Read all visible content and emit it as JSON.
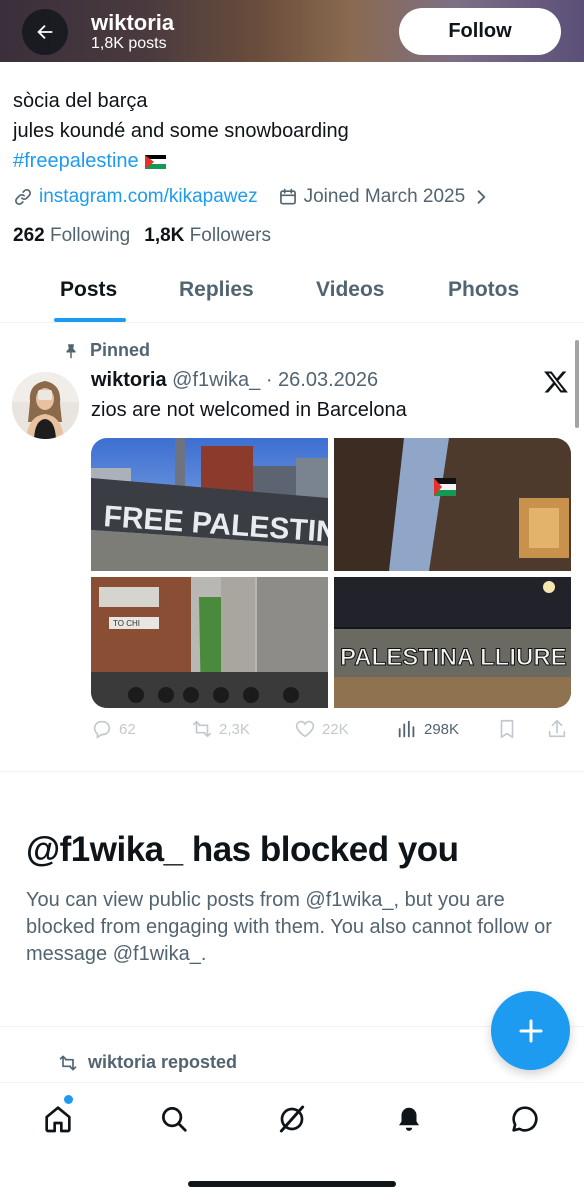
{
  "header": {
    "name": "wiktoria",
    "posts_count": "1,8K posts",
    "follow_label": "Follow"
  },
  "bio": {
    "line1": "sòcia del barça",
    "line2": "jules koundé and some snowboarding",
    "hashtag": "#freepalestine",
    "link": "instagram.com/kikapawez",
    "joined": "Joined March 2025"
  },
  "counts": {
    "following_num": "262",
    "following_label": "Following",
    "followers_num": "1,8K",
    "followers_label": "Followers"
  },
  "tabs": [
    {
      "label": "Posts",
      "active": true
    },
    {
      "label": "Replies",
      "active": false
    },
    {
      "label": "Videos",
      "active": false
    },
    {
      "label": "Photos",
      "active": false
    }
  ],
  "post": {
    "pinned_label": "Pinned",
    "author": "wiktoria",
    "handle": "@f1wika_",
    "date": "· 26.03.2026",
    "text": "zios are not welcomed in Barcelona",
    "mural1_text": "FREE  PALESTINA",
    "mural2_text": "PALESTINA  LLIURE",
    "sign_text": "TO CHI",
    "actions": {
      "replies": "62",
      "reposts": "2,3K",
      "likes": "22K",
      "views": "298K"
    }
  },
  "blocked": {
    "title": "@f1wika_ has blocked you",
    "text": "You can view public posts from @f1wika_, but you are blocked from engaging with them. You also cannot follow or message @f1wika_."
  },
  "repost": {
    "label": "wiktoria reposted"
  },
  "colors": {
    "accent": "#1d9bf0",
    "text_primary": "#0f1419",
    "text_secondary": "#536471"
  },
  "icons": {
    "back": "arrow-left-icon",
    "link": "link-icon",
    "calendar": "calendar-icon",
    "pin": "pin-icon",
    "x_logo": "x-logo-icon",
    "reply": "reply-icon",
    "repost": "repost-icon",
    "like": "heart-icon",
    "views": "views-icon",
    "bookmark": "bookmark-icon",
    "share": "share-icon",
    "compose": "plus-icon",
    "nav": [
      "home-icon",
      "search-icon",
      "grok-icon",
      "bell-icon",
      "messages-icon"
    ]
  }
}
